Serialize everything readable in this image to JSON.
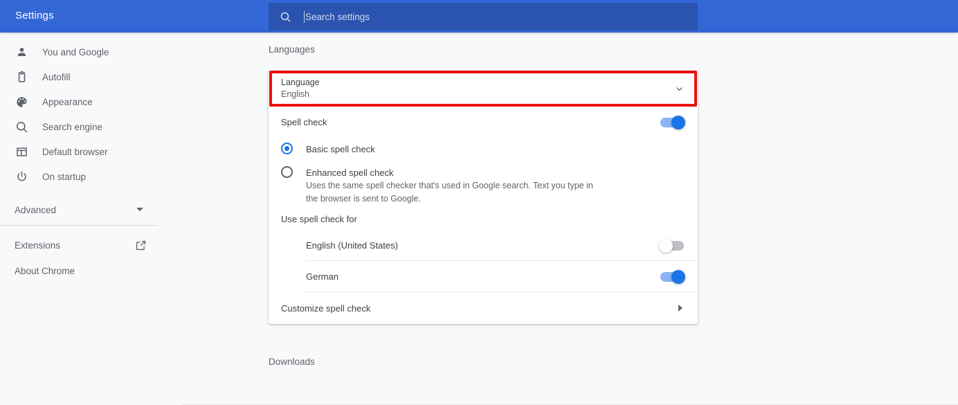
{
  "header": {
    "title": "Settings",
    "search": {
      "placeholder": "Search settings",
      "value": "",
      "icon": "search-icon"
    },
    "background_color": "#3367d6",
    "search_background_color": "#2b54b0"
  },
  "sidebar": {
    "items": [
      {
        "label": "You and Google",
        "icon": "person-icon"
      },
      {
        "label": "Autofill",
        "icon": "clipboard-icon"
      },
      {
        "label": "Appearance",
        "icon": "palette-icon"
      },
      {
        "label": "Search engine",
        "icon": "search-icon"
      },
      {
        "label": "Default browser",
        "icon": "browser-window-icon"
      },
      {
        "label": "On startup",
        "icon": "power-icon"
      }
    ],
    "advanced": {
      "label": "Advanced",
      "icon": "chevron-down-icon"
    },
    "extensions": {
      "label": "Extensions",
      "icon": "open-in-new-icon"
    },
    "about": {
      "label": "About Chrome"
    }
  },
  "main": {
    "section_title": "Languages",
    "language_row": {
      "title": "Language",
      "value": "English",
      "icon": "chevron-down-icon",
      "highlight_color": "#e8130e",
      "highlighted": true
    },
    "spell_check": {
      "label": "Spell check",
      "enabled": true,
      "options": [
        {
          "label": "Basic spell check",
          "description": "",
          "selected": true
        },
        {
          "label": "Enhanced spell check",
          "description": "Uses the same spell checker that's used in Google search. Text you type in the browser is sent to Google.",
          "selected": false
        }
      ],
      "use_for_label": "Use spell check for",
      "languages": [
        {
          "label": "English (United States)",
          "enabled": false
        },
        {
          "label": "German",
          "enabled": true
        }
      ],
      "customize": {
        "label": "Customize spell check",
        "icon": "chevron-right-icon"
      }
    },
    "downloads_title": "Downloads"
  },
  "colors": {
    "accent": "#1a73e8",
    "toggle_on_track": "#8ab4f8",
    "toggle_off_track": "#bdc1c6",
    "page_background": "#f8f9fa"
  }
}
